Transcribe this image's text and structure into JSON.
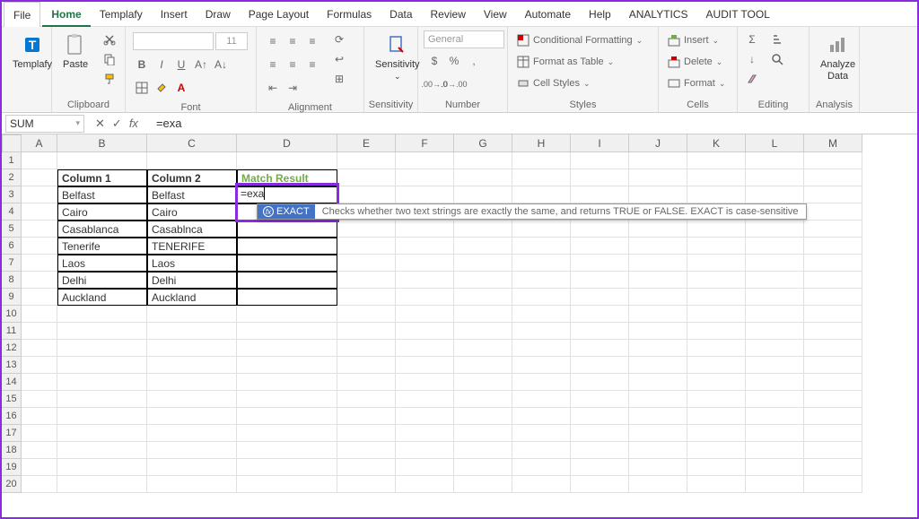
{
  "tabs": [
    "File",
    "Home",
    "Templafy",
    "Insert",
    "Draw",
    "Page Layout",
    "Formulas",
    "Data",
    "Review",
    "View",
    "Automate",
    "Help",
    "ANALYTICS",
    "AUDIT TOOL"
  ],
  "activeTab": "Home",
  "ribbon": {
    "templafy": "Templafy",
    "paste": "Paste",
    "sensitivity": "Sensitivity",
    "analyze": "Analyze\nData",
    "numberFormat": "General",
    "condFormat": "Conditional Formatting",
    "formatTable": "Format as Table",
    "cellStyles": "Cell Styles",
    "insert": "Insert",
    "delete": "Delete",
    "format": "Format",
    "groups": {
      "clipboard": "Clipboard",
      "font": "Font",
      "alignment": "Alignment",
      "sensitivity": "Sensitivity",
      "number": "Number",
      "styles": "Styles",
      "cells": "Cells",
      "editing": "Editing",
      "analysis": "Analysis"
    }
  },
  "nameBox": "SUM",
  "formulaBar": "=exa",
  "columns": [
    "A",
    "B",
    "C",
    "D",
    "E",
    "F",
    "G",
    "H",
    "I",
    "J",
    "K",
    "L",
    "M"
  ],
  "rows": [
    "1",
    "2",
    "3",
    "4",
    "5",
    "6",
    "7",
    "8",
    "9",
    "10",
    "11",
    "12",
    "13",
    "14",
    "15",
    "16",
    "17",
    "18",
    "19",
    "20"
  ],
  "table": {
    "headers": [
      "Column 1",
      "Column 2",
      "Match Result"
    ],
    "data": [
      [
        "Belfast",
        "Belfast"
      ],
      [
        "Cairo",
        "Cairo"
      ],
      [
        "Casablanca",
        "Casablnca"
      ],
      [
        "Tenerife",
        "TENERIFE"
      ],
      [
        "Laos",
        "Laos"
      ],
      [
        "Delhi",
        "Delhi"
      ],
      [
        "Auckland",
        "Auckland"
      ]
    ]
  },
  "editingCell": "=exa",
  "autocomplete": {
    "fn": "EXACT",
    "desc": "Checks whether two text strings are exactly the same, and returns TRUE or FALSE. EXACT is case-sensitive"
  }
}
